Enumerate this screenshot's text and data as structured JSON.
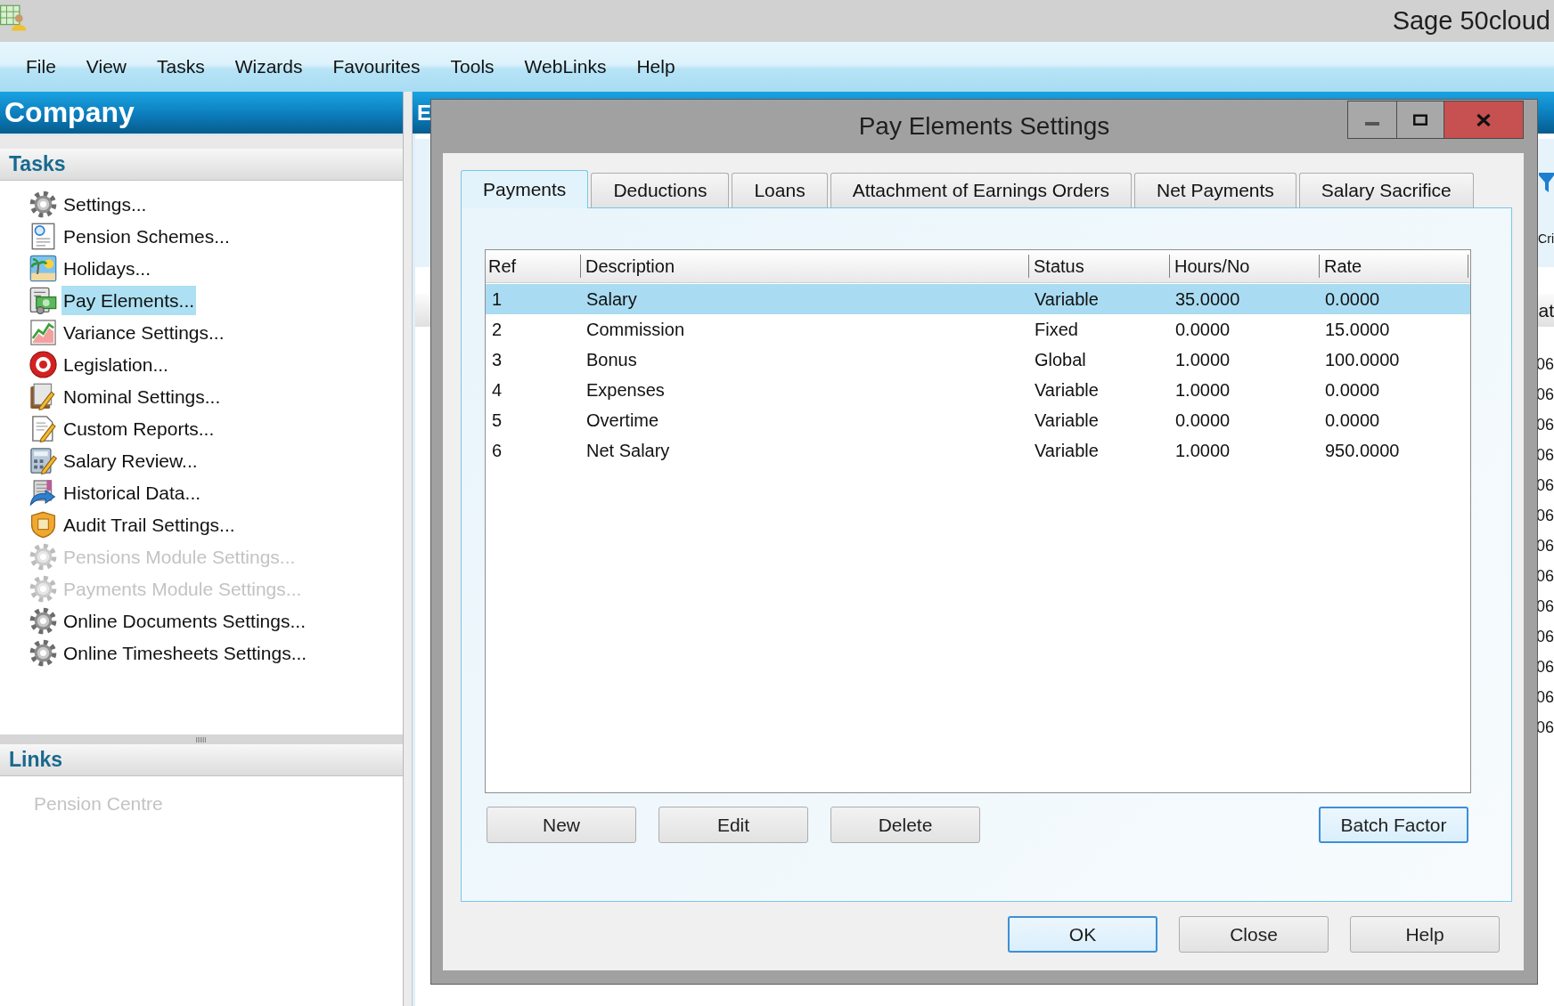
{
  "title_bar": {
    "title": "Sage 50cloud"
  },
  "menu_bar": [
    {
      "label": "File"
    },
    {
      "label": "View"
    },
    {
      "label": "Tasks"
    },
    {
      "label": "Wizards"
    },
    {
      "label": "Favourites"
    },
    {
      "label": "Tools"
    },
    {
      "label": "WebLinks"
    },
    {
      "label": "Help"
    }
  ],
  "sidebar": {
    "title": "Company",
    "sections": [
      {
        "title": "Tasks",
        "kind": "tasks",
        "items": [
          {
            "label": "Settings...",
            "selected": false,
            "disabled": false
          },
          {
            "label": "Pension Schemes...",
            "selected": false,
            "disabled": false
          },
          {
            "label": "Holidays...",
            "selected": false,
            "disabled": false
          },
          {
            "label": "Pay Elements...",
            "selected": true,
            "disabled": false
          },
          {
            "label": "Variance Settings...",
            "selected": false,
            "disabled": false
          },
          {
            "label": "Legislation...",
            "selected": false,
            "disabled": false
          },
          {
            "label": "Nominal Settings...",
            "selected": false,
            "disabled": false
          },
          {
            "label": "Custom Reports...",
            "selected": false,
            "disabled": false
          },
          {
            "label": "Salary Review...",
            "selected": false,
            "disabled": false
          },
          {
            "label": "Historical Data...",
            "selected": false,
            "disabled": false
          },
          {
            "label": "Audit Trail Settings...",
            "selected": false,
            "disabled": false
          },
          {
            "label": "Pensions Module Settings...",
            "selected": false,
            "disabled": true
          },
          {
            "label": "Payments Module Settings...",
            "selected": false,
            "disabled": true
          },
          {
            "label": "Online Documents Settings...",
            "selected": false,
            "disabled": false
          },
          {
            "label": "Online Timesheets Settings...",
            "selected": false,
            "disabled": false
          }
        ]
      },
      {
        "title": "Links",
        "kind": "links",
        "items": [
          {
            "label": "Pension Centre",
            "selected": false,
            "disabled": true
          }
        ]
      }
    ]
  },
  "main_panel": {
    "title": "E",
    "filter_label": "Cri",
    "column_header": "at",
    "cells": [
      "06",
      "06",
      "06",
      "06",
      "06",
      "06",
      "06",
      "06",
      "06",
      "06",
      "06",
      "06",
      "06"
    ]
  },
  "dialog": {
    "title": "Pay Elements Settings",
    "tabs": [
      {
        "label": "Payments",
        "selected": true
      },
      {
        "label": "Deductions",
        "selected": false
      },
      {
        "label": "Loans",
        "selected": false
      },
      {
        "label": "Attachment of Earnings Orders",
        "selected": false
      },
      {
        "label": "Net Payments",
        "selected": false
      },
      {
        "label": "Salary Sacrifice",
        "selected": false
      }
    ],
    "table": {
      "columns": [
        "Ref",
        "Description",
        "Status",
        "Hours/No",
        "Rate"
      ],
      "rows": [
        {
          "cells": [
            "1",
            "Salary",
            "Variable",
            "35.0000",
            "0.0000"
          ],
          "selected": true
        },
        {
          "cells": [
            "2",
            "Commission",
            "Fixed",
            "0.0000",
            "15.0000"
          ],
          "selected": false
        },
        {
          "cells": [
            "3",
            "Bonus",
            "Global",
            "1.0000",
            "100.0000"
          ],
          "selected": false
        },
        {
          "cells": [
            "4",
            "Expenses",
            "Variable",
            "1.0000",
            "0.0000"
          ],
          "selected": false
        },
        {
          "cells": [
            "5",
            "Overtime",
            "Variable",
            "0.0000",
            "0.0000"
          ],
          "selected": false
        },
        {
          "cells": [
            "6",
            "Net Salary",
            "Variable",
            "1.0000",
            "950.0000"
          ],
          "selected": false
        }
      ]
    },
    "panel_buttons": [
      {
        "label": "New",
        "default": false
      },
      {
        "label": "Edit",
        "default": false
      },
      {
        "label": "Delete",
        "default": false
      },
      {
        "label": "Batch Factor",
        "default": true
      }
    ],
    "footer_buttons": [
      {
        "label": "OK",
        "default": true
      },
      {
        "label": "Close",
        "default": false
      },
      {
        "label": "Help",
        "default": false
      }
    ]
  }
}
